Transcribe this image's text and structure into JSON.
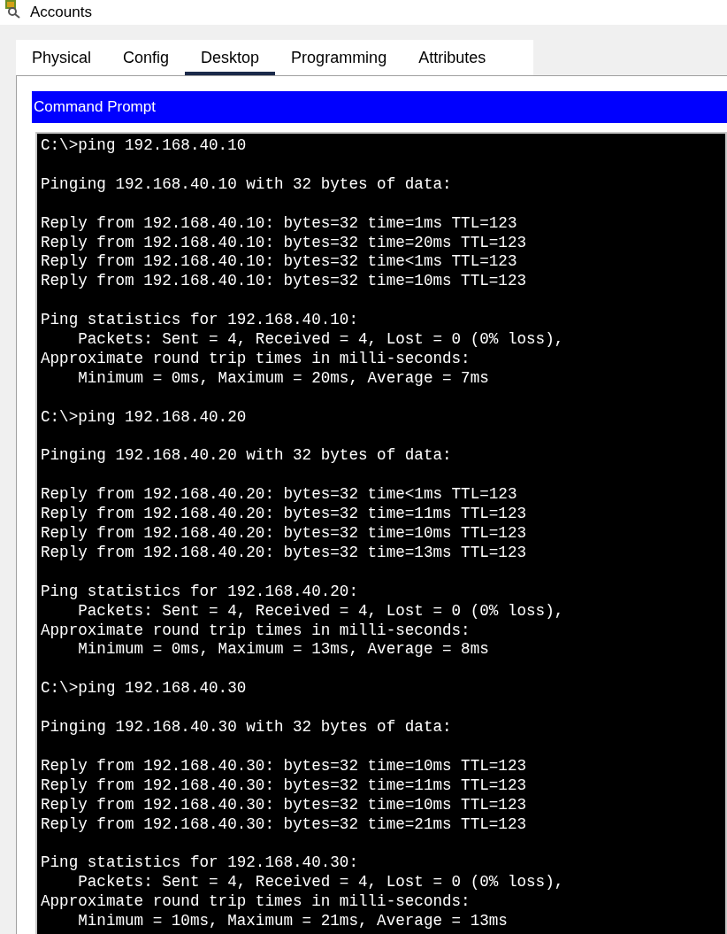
{
  "window": {
    "title": "Accounts"
  },
  "tabs": [
    {
      "label": "Physical",
      "selected": false
    },
    {
      "label": "Config",
      "selected": false
    },
    {
      "label": "Desktop",
      "selected": true
    },
    {
      "label": "Programming",
      "selected": false
    },
    {
      "label": "Attributes",
      "selected": false
    }
  ],
  "app": {
    "title": "Command Prompt"
  },
  "terminal": {
    "blocks": [
      [
        "C:\\>ping 192.168.40.10"
      ],
      [
        "Pinging 192.168.40.10 with 32 bytes of data:"
      ],
      [
        "Reply from 192.168.40.10: bytes=32 time=1ms TTL=123",
        "Reply from 192.168.40.10: bytes=32 time=20ms TTL=123",
        "Reply from 192.168.40.10: bytes=32 time<1ms TTL=123",
        "Reply from 192.168.40.10: bytes=32 time=10ms TTL=123"
      ],
      [
        "Ping statistics for 192.168.40.10:",
        "    Packets: Sent = 4, Received = 4, Lost = 0 (0% loss),",
        "Approximate round trip times in milli-seconds:",
        "    Minimum = 0ms, Maximum = 20ms, Average = 7ms"
      ],
      [
        "C:\\>ping 192.168.40.20"
      ],
      [
        "Pinging 192.168.40.20 with 32 bytes of data:"
      ],
      [
        "Reply from 192.168.40.20: bytes=32 time<1ms TTL=123",
        "Reply from 192.168.40.20: bytes=32 time=11ms TTL=123",
        "Reply from 192.168.40.20: bytes=32 time=10ms TTL=123",
        "Reply from 192.168.40.20: bytes=32 time=13ms TTL=123"
      ],
      [
        "Ping statistics for 192.168.40.20:",
        "    Packets: Sent = 4, Received = 4, Lost = 0 (0% loss),",
        "Approximate round trip times in milli-seconds:",
        "    Minimum = 0ms, Maximum = 13ms, Average = 8ms"
      ],
      [
        "C:\\>ping 192.168.40.30"
      ],
      [
        "Pinging 192.168.40.30 with 32 bytes of data:"
      ],
      [
        "Reply from 192.168.40.30: bytes=32 time=10ms TTL=123",
        "Reply from 192.168.40.30: bytes=32 time=11ms TTL=123",
        "Reply from 192.168.40.30: bytes=32 time=10ms TTL=123",
        "Reply from 192.168.40.30: bytes=32 time=21ms TTL=123"
      ],
      [
        "Ping statistics for 192.168.40.30:",
        "    Packets: Sent = 4, Received = 4, Lost = 0 (0% loss),",
        "Approximate round trip times in milli-seconds:",
        "    Minimum = 10ms, Maximum = 21ms, Average = 13ms"
      ]
    ]
  }
}
